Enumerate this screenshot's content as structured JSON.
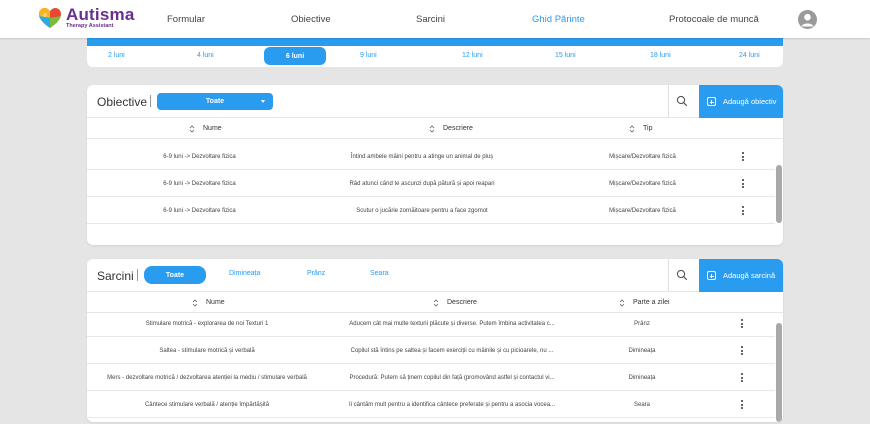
{
  "brand": {
    "title": "Autisma",
    "subtitle": "Therapy Assistant"
  },
  "nav": {
    "items": [
      "Formular",
      "Obiective",
      "Sarcini",
      "Ghid Părinte",
      "Protocoale de muncă"
    ],
    "active_index": 3
  },
  "ages": {
    "items": [
      "2 luni",
      "4 luni",
      "6 luni",
      "9 luni",
      "12 luni",
      "15 luni",
      "18 luni",
      "24 luni"
    ],
    "active_index": 2
  },
  "objectives": {
    "title": "Obiective",
    "filter_value": "Toate",
    "add_label": "Adaugă obiectiv",
    "columns": [
      "Nume",
      "Descriere",
      "Tip"
    ],
    "rows": [
      {
        "name": "6-9 luni -> Dezvoltare fizica",
        "description": "Întind ambele mâini pentru a atinge un animal de pluș",
        "type": "Mișcare/Dezvoltare fizică"
      },
      {
        "name": "6-9 luni -> Dezvoltare fizica",
        "description": "Râd atunci când te ascunzi după pătură și apoi reapari",
        "type": "Mișcare/Dezvoltare fizică"
      },
      {
        "name": "6-9 luni -> Dezvoltare fizica",
        "description": "Scutur o jucărie zornăitoare pentru a face zgomot",
        "type": "Mișcare/Dezvoltare fizică"
      }
    ]
  },
  "tasks": {
    "title": "Sarcini",
    "tabs": [
      "Toate",
      "Dimineața",
      "Prânz",
      "Seara"
    ],
    "active_tab": 0,
    "add_label": "Adaugă sarcină",
    "columns": [
      "Nume",
      "Descriere",
      "Parte a zilei"
    ],
    "rows": [
      {
        "name": "Stimulare motrică - explorarea de noi Texturi 1",
        "description": "Aducem cât mai multe texturii plăcute și diverse. Putem îmbina activitatea c...",
        "part": "Prânz"
      },
      {
        "name": "Saltea - stimulare motrică și verbală",
        "description": "Copilul stă întins pe saltea și facem exerciții cu mâinile și cu picioarele, nu ...",
        "part": "Dimineața"
      },
      {
        "name": "Mers - dezvoltare motrică / dezvoltarea atenției la mediu / stimulare verbală",
        "description": "Procedură: Putem să ținem copilul din față (promovând astfel și contactul vi...",
        "part": "Dimineața"
      },
      {
        "name": "Cântece stimulare verbală / atenție împărtășită",
        "description": "Ii cântăm mult pentru a identifica cântece preferate și pentru a asocia vocea...",
        "part": "Seara"
      }
    ]
  },
  "colors": {
    "accent": "#2a9cf0",
    "brand": "#6a2f8e",
    "background": "#e5e5e5"
  }
}
